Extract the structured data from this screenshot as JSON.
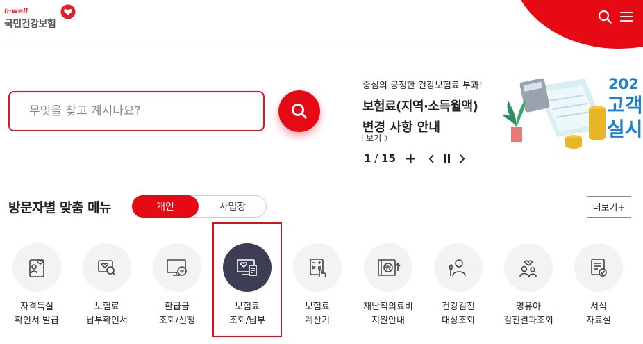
{
  "brand": {
    "sub": "h·well",
    "name": "국민건강보험"
  },
  "header": {
    "search_icon": "search-icon",
    "menu_icon": "hamburger-menu-icon"
  },
  "search": {
    "placeholder": "무엇을 찾고 계시나요?",
    "value": ""
  },
  "banner": {
    "line1": "중심의 공정한 건강보험료 부과!",
    "line2": "보험료(지역·소득월액)",
    "line3": "변경 사항 안내",
    "more": "l 보기 〉",
    "page_current": "1",
    "page_sep": " / ",
    "page_total": "15",
    "plus": "+",
    "image_text_year": "202",
    "image_text_1": "고객",
    "image_text_2": "실시"
  },
  "menu_section": {
    "title": "방문자별 맞춤 메뉴",
    "toggle_personal": "개인",
    "toggle_business": "사업장",
    "more": "더보기+"
  },
  "menu_items": [
    {
      "icon": "id-card-heart-icon",
      "line1": "자격득실",
      "line2": "확인서 발급"
    },
    {
      "icon": "insurance-search-icon",
      "line1": "보험료",
      "line2": "납부확인서"
    },
    {
      "icon": "refund-monitor-icon",
      "line1": "환급금",
      "line2": "조회/신청"
    },
    {
      "icon": "insurance-payment-icon",
      "line1": "보험료",
      "line2": "조회/납부"
    },
    {
      "icon": "calculator-icon",
      "line1": "보험료",
      "line2": "계산기"
    },
    {
      "icon": "medical-support-icon",
      "line1": "재난적의료비",
      "line2": "지원안내"
    },
    {
      "icon": "health-checkup-icon",
      "line1": "건강검진",
      "line2": "대상조회"
    },
    {
      "icon": "infant-checkup-icon",
      "line1": "영유아",
      "line2": "검진결과조회"
    },
    {
      "icon": "documents-icon",
      "line1": "서식",
      "line2": "자료실"
    }
  ],
  "colors": {
    "accent": "#e60a14",
    "active_icon_bg": "#3d3e55",
    "icon_bg": "#f3f3f3"
  }
}
